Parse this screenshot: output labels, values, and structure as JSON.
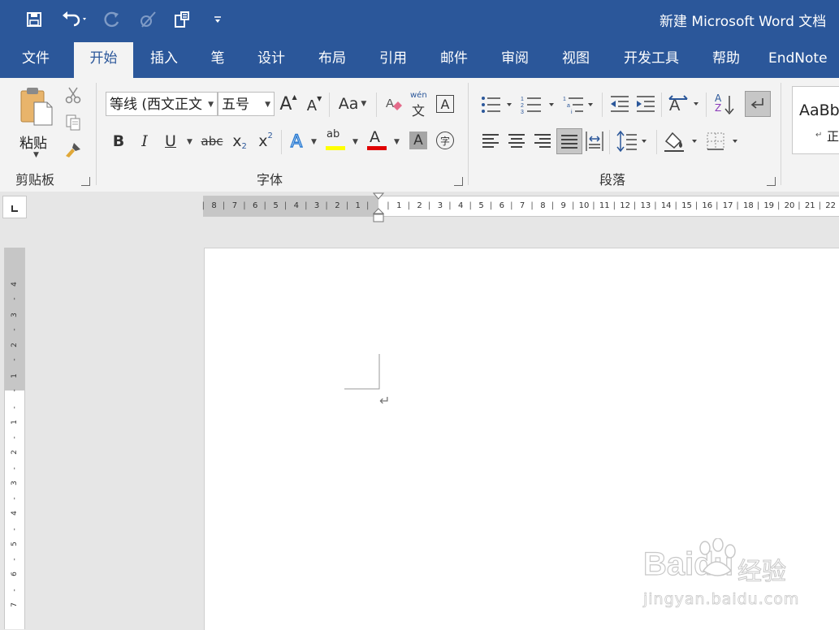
{
  "window": {
    "title": "新建 Microsoft Word 文档"
  },
  "quick_access": [
    "save-icon",
    "undo-icon",
    "redo-icon",
    "touch-mode-icon",
    "format-painter-icon",
    "customize-icon"
  ],
  "tabs": [
    "文件",
    "开始",
    "插入",
    "笔",
    "设计",
    "布局",
    "引用",
    "邮件",
    "审阅",
    "视图",
    "开发工具",
    "帮助",
    "EndNote"
  ],
  "active_tab": "开始",
  "clipboard": {
    "paste_label": "粘贴",
    "group_label": "剪贴板"
  },
  "font": {
    "name": "等线 (西文正文",
    "size": "五号",
    "group_label": "字体",
    "aa_label": "Aa",
    "bold": "B",
    "italic": "I",
    "underline": "U",
    "strike": "abc",
    "sub": "x",
    "sub_mark": "2",
    "sup": "x",
    "sup_mark": "2",
    "grow": "A",
    "shrink": "A",
    "effects": "A",
    "color": "A",
    "shade": "A",
    "highlight": "ab",
    "phonetic_top": "wén",
    "phonetic_bottom": "文",
    "border": "A",
    "enclose": "字",
    "highlight_color": "#ffff00",
    "font_color": "#e00000"
  },
  "paragraph": {
    "group_label": "段落",
    "sort_a": "A",
    "sort_z": "Z"
  },
  "styles": {
    "sample": "AaBb",
    "name": "正"
  },
  "ruler": {
    "left_numbers": [
      "8",
      "7",
      "6",
      "5",
      "4",
      "3",
      "2",
      "1"
    ],
    "right_numbers": [
      "1",
      "2",
      "3",
      "4",
      "5",
      "6",
      "7",
      "8",
      "9",
      "10",
      "11",
      "12",
      "13",
      "14",
      "15",
      "16",
      "17",
      "18",
      "19",
      "20",
      "21",
      "22"
    ],
    "vertical_top": [
      "4",
      "3",
      "2",
      "1"
    ],
    "vertical_bottom": [
      "1",
      "2",
      "3",
      "4",
      "5",
      "6",
      "7"
    ]
  },
  "document": {
    "paragraph_mark": "↵"
  },
  "watermark": {
    "brand": "Baidu",
    "brand_cn": "经验",
    "url": "jingyan.baidu.com"
  },
  "colors": {
    "brand": "#2b579a",
    "ribbon_bg": "#f3f3f3"
  }
}
